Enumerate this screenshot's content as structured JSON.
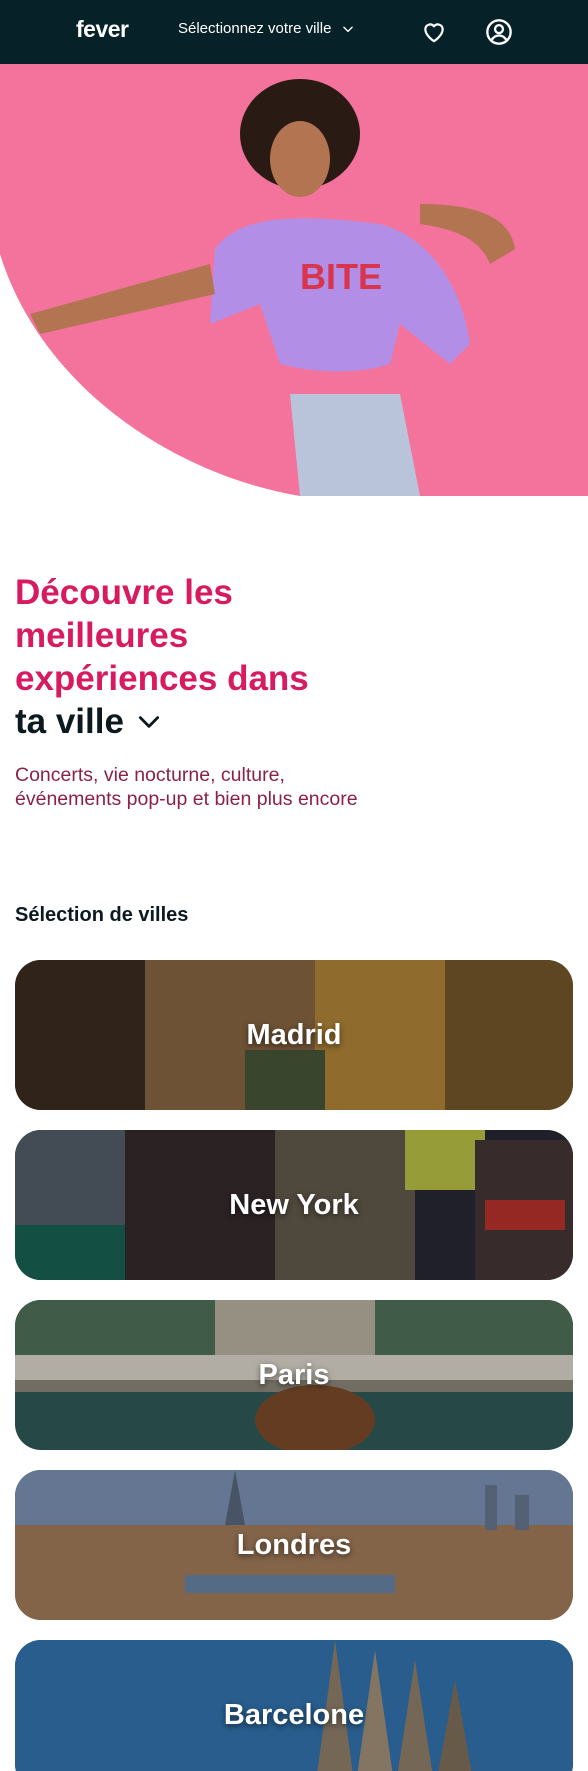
{
  "header": {
    "logo": "fever",
    "city_select_label": "Sélectionnez votre ville",
    "icons": [
      "heart-icon",
      "user-icon",
      "chevron-down-icon"
    ]
  },
  "hero": {
    "image": "woman-dancing-pink-background",
    "accent_color": "#f4739c"
  },
  "headline": {
    "line1": "Découvre les",
    "line2": "meilleures",
    "line3": "expériences dans",
    "line4": "ta ville"
  },
  "subtitle": "Concerts, vie nocturne, culture, événements pop-up et bien plus encore",
  "cities_section": {
    "title": "Sélection de villes",
    "cities": [
      {
        "name": "Madrid"
      },
      {
        "name": "New York"
      },
      {
        "name": "Paris"
      },
      {
        "name": "Londres"
      },
      {
        "name": "Barcelone"
      }
    ]
  },
  "colors": {
    "header_bg": "#062128",
    "headline_pink": "#d81b60",
    "subtitle": "#8a2244"
  }
}
